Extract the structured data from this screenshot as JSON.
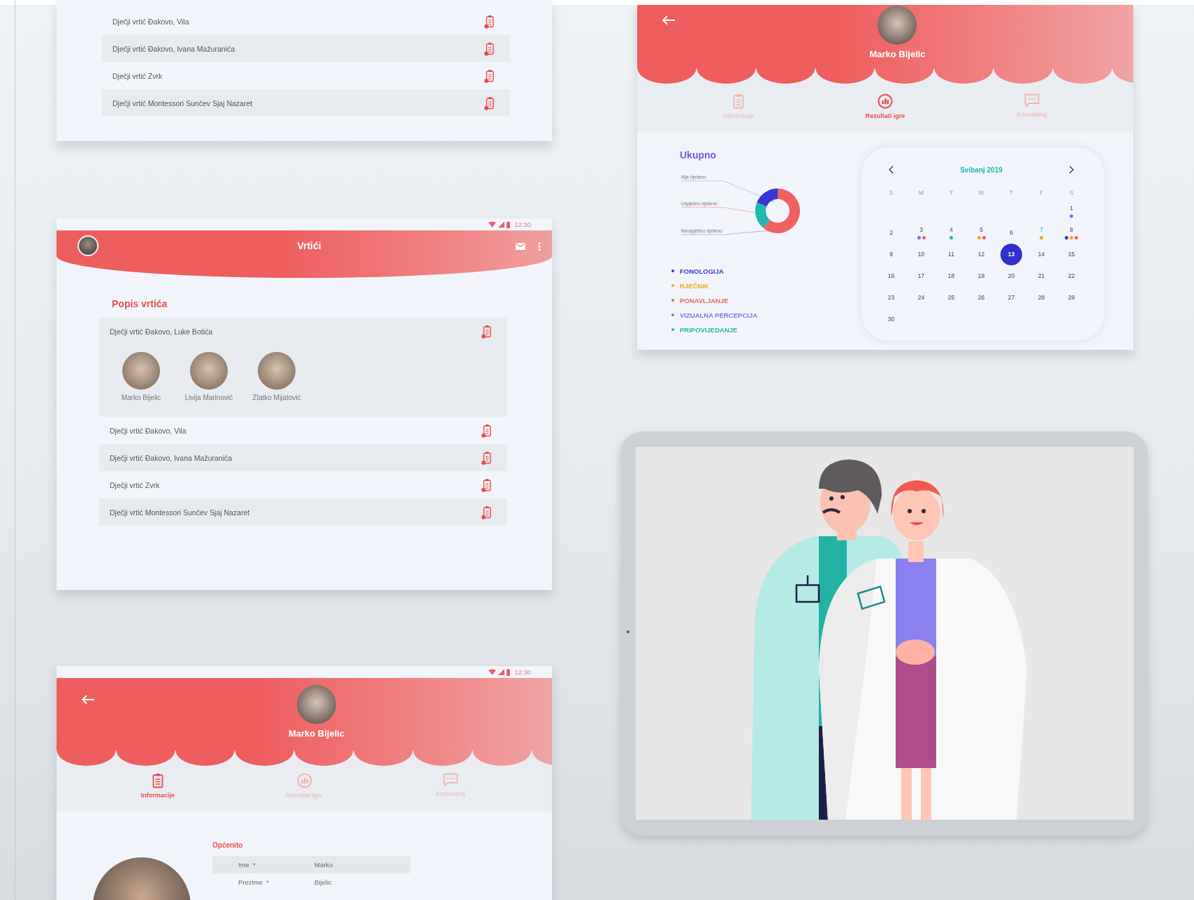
{
  "kindergarten_list_preview": {
    "rows": [
      {
        "name": "Dječji vrtić Đakovo, Vila"
      },
      {
        "name": "Dječji vrtić Đakovo, Ivana Mažuranića"
      },
      {
        "name": "Dječji vrtić Zvrk"
      },
      {
        "name": "Dječji vrtić Montessori Sunčev Sjaj Nazaret"
      }
    ]
  },
  "kindergarten_list": {
    "status_bar": {
      "time": "12:30"
    },
    "title": "Vrtići",
    "section_title": "Popis vrtića",
    "rows": [
      {
        "name": "Dječji vrtić Đakovo, Luke Botića",
        "expanded": true,
        "children": [
          {
            "name": "Marko Bijelic"
          },
          {
            "name": "Livija Marinović"
          },
          {
            "name": "Zlatko Mijatović"
          }
        ]
      },
      {
        "name": "Dječji vrtić Đakovo, Vila",
        "expanded": false
      },
      {
        "name": "Dječji vrtić Đakovo, Ivana Mažuranića",
        "expanded": false
      },
      {
        "name": "Dječji vrtić Zvrk",
        "expanded": false
      },
      {
        "name": "Dječji vrtić Montessori Sunčev Sjaj Nazaret",
        "expanded": false
      }
    ]
  },
  "child_results": {
    "child_name": "Marko Bijelic",
    "tabs": [
      {
        "label": "Informacije",
        "selected": false
      },
      {
        "label": "Rezultati igre",
        "selected": true
      },
      {
        "label": "Kontaktiraj",
        "selected": false
      }
    ],
    "summary_title": "Ukupno",
    "donut_labels": [
      "Nije riješeno",
      "Uspješno riješeno",
      "Neuspješno riješeno"
    ],
    "legend": [
      {
        "label": "FONOLOGIJA",
        "color": "#3a36d6"
      },
      {
        "label": "RJEČNIK",
        "color": "#f0a818"
      },
      {
        "label": "PONAVLJANJE",
        "color": "#f06262"
      },
      {
        "label": "VIZUALNA PERCEPCIJA",
        "color": "#7b70ef"
      },
      {
        "label": "PRIPOVIJEDANJE",
        "color": "#22b8b0"
      }
    ],
    "calendar": {
      "month": "Svibanj 2019",
      "weekdays": [
        "S",
        "M",
        "T",
        "W",
        "T",
        "F",
        "S"
      ],
      "weeks": [
        [
          {
            "day": "1",
            "selected": false,
            "marked": false,
            "dots": [
              {
                "color": "#7b70ef"
              }
            ]
          }
        ],
        [
          {
            "day": "2",
            "selected": false,
            "marked": false
          },
          {
            "day": "3",
            "selected": false,
            "marked": false,
            "dots": [
              {
                "color": "#7b70ef"
              },
              {
                "color": "#f06262"
              }
            ]
          },
          {
            "day": "4",
            "selected": false,
            "marked": false,
            "dots": [
              {
                "color": "#22b8b0"
              }
            ]
          },
          {
            "day": "5",
            "selected": false,
            "marked": false,
            "dots": [
              {
                "color": "#f0a818"
              },
              {
                "color": "#f06262"
              }
            ]
          },
          {
            "day": "6",
            "selected": false,
            "marked": false
          },
          {
            "day": "7",
            "selected": false,
            "marked": true,
            "dots": [
              {
                "color": "#f0a818"
              }
            ]
          },
          {
            "day": "8",
            "selected": false,
            "marked": false,
            "dots": [
              {
                "color": "#3a36d6"
              },
              {
                "color": "#f0a818"
              },
              {
                "color": "#f06262"
              }
            ]
          }
        ],
        [
          {
            "day": "9",
            "selected": false,
            "marked": false
          },
          {
            "day": "10",
            "selected": false,
            "marked": false
          },
          {
            "day": "11",
            "selected": false,
            "marked": false
          },
          {
            "day": "12",
            "selected": false,
            "marked": false
          },
          {
            "day": "13",
            "selected": true,
            "marked": false
          },
          {
            "day": "14",
            "selected": false,
            "marked": false
          },
          {
            "day": "15",
            "selected": false,
            "marked": false
          }
        ],
        [
          {
            "day": "16",
            "selected": false,
            "marked": false
          },
          {
            "day": "17",
            "selected": false,
            "marked": false
          },
          {
            "day": "18",
            "selected": false,
            "marked": false
          },
          {
            "day": "19",
            "selected": false,
            "marked": false
          },
          {
            "day": "20",
            "selected": false,
            "marked": false
          },
          {
            "day": "21",
            "selected": false,
            "marked": false
          },
          {
            "day": "22",
            "selected": false,
            "marked": false
          }
        ],
        [
          {
            "day": "23",
            "selected": false,
            "marked": false
          },
          {
            "day": "24",
            "selected": false,
            "marked": false
          },
          {
            "day": "25",
            "selected": false,
            "marked": false
          },
          {
            "day": "26",
            "selected": false,
            "marked": false
          },
          {
            "day": "27",
            "selected": false,
            "marked": false
          },
          {
            "day": "28",
            "selected": false,
            "marked": false
          },
          {
            "day": "29",
            "selected": false,
            "marked": false
          }
        ],
        [
          {
            "day": "30",
            "selected": false,
            "marked": false
          }
        ]
      ]
    }
  },
  "child_info": {
    "status_bar": {
      "time": "12:30"
    },
    "child_name": "Marko Bijelic",
    "tabs": [
      {
        "label": "Informacije",
        "selected": true
      },
      {
        "label": "Rezultati igre",
        "selected": false
      },
      {
        "label": "Kontaktiraj",
        "selected": false
      }
    ],
    "section_title": "Općenito",
    "fields": [
      {
        "label": "Ime  *",
        "value": "Marko"
      },
      {
        "label": "Prezime  *",
        "value": "Bijelic"
      }
    ]
  }
}
